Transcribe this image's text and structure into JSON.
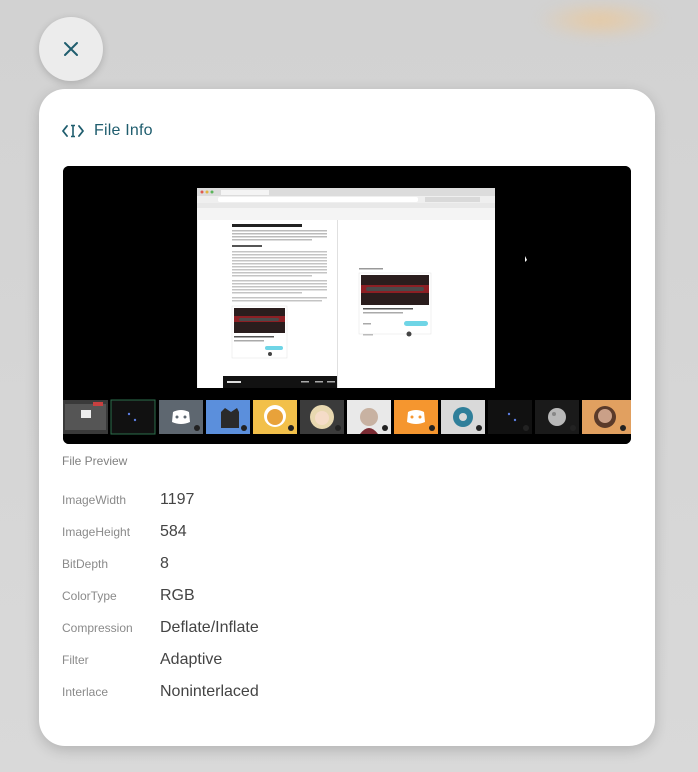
{
  "header": {
    "title": "File Info",
    "icon": "code-cursor-icon"
  },
  "close": {
    "icon": "close-icon"
  },
  "preview": {
    "caption": "File Preview",
    "browser_url": "docs.google.com/document/d/1bM0nr9Eae0KFNuDDc5Ip/edit",
    "doc_title": "Contemporary Trend You Should Grow",
    "doc_section": "The trend is",
    "doc_footer_brand": "AVID.com",
    "participants": [
      "screen-share-tile",
      "dots-tile",
      "discord-tile",
      "cat-tile",
      "dog-tile",
      "anime-tile",
      "person-tile",
      "discord-orange-tile",
      "crystal-tile",
      "dots-tile-2",
      "moon-tile",
      "avatar-tile"
    ]
  },
  "metadata": [
    {
      "key": "ImageWidth",
      "value": "1197"
    },
    {
      "key": "ImageHeight",
      "value": "584"
    },
    {
      "key": "BitDepth",
      "value": "8"
    },
    {
      "key": "ColorType",
      "value": "RGB"
    },
    {
      "key": "Compression",
      "value": "Deflate/Inflate"
    },
    {
      "key": "Filter",
      "value": "Adaptive"
    },
    {
      "key": "Interlace",
      "value": "Noninterlaced"
    }
  ],
  "colors": {
    "accent": "#1f5d6e",
    "card": "#ffffff",
    "backdrop": "#d4d4d4"
  }
}
